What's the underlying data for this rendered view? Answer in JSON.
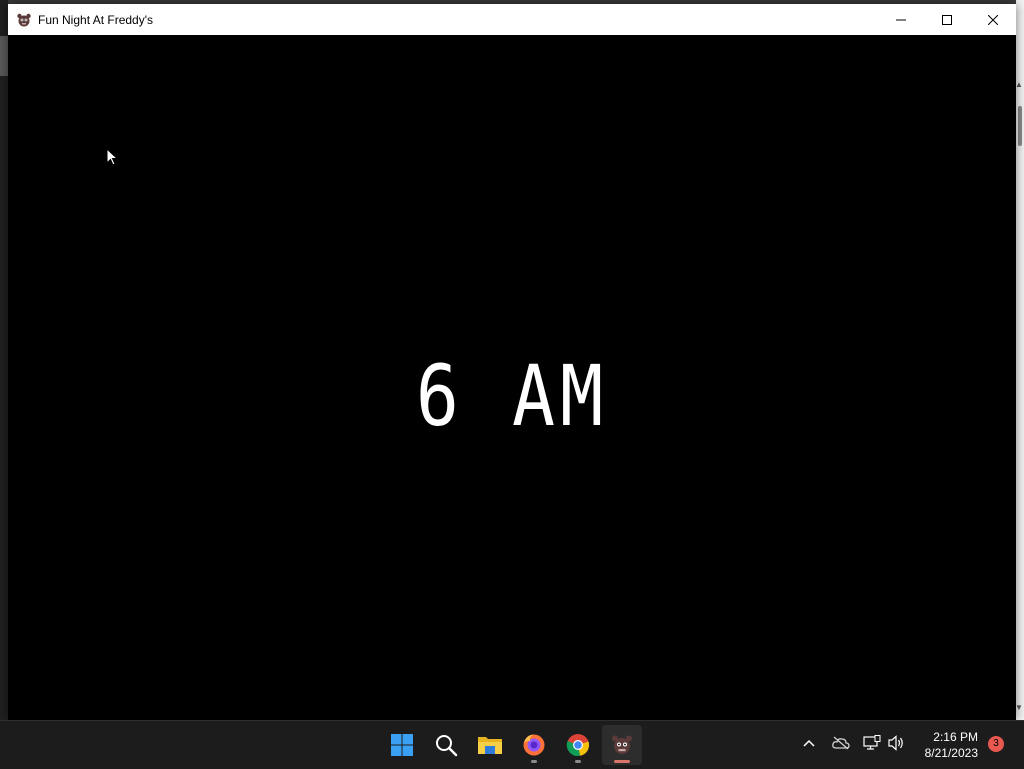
{
  "window": {
    "title": "Fun Night At Freddy's",
    "app_icon": "freddy-app-icon",
    "controls": [
      "minimize-icon",
      "maximize-icon",
      "close-icon"
    ]
  },
  "game": {
    "time_text": "6 AM",
    "background_color": "#000000",
    "text_color": "#ffffff"
  },
  "taskbar": {
    "pinned": [
      {
        "name": "start-button",
        "icon": "windows-logo-icon"
      },
      {
        "name": "search-button",
        "icon": "search-icon"
      },
      {
        "name": "file-explorer",
        "icon": "folder-icon"
      },
      {
        "name": "firefox",
        "icon": "firefox-icon",
        "running": true
      },
      {
        "name": "chrome",
        "icon": "chrome-icon",
        "running": true
      },
      {
        "name": "fun-night-at-freddys",
        "icon": "freddy-app-icon",
        "running": true,
        "active": true
      }
    ],
    "tray": {
      "icons": [
        "chevron-up-icon",
        "onedrive-offline-icon",
        "network-icon",
        "volume-icon"
      ],
      "time": "2:16 PM",
      "date": "8/21/2023",
      "notification_count": "3"
    },
    "accent_active": "#d9756a",
    "badge_color": "#e8584e"
  }
}
